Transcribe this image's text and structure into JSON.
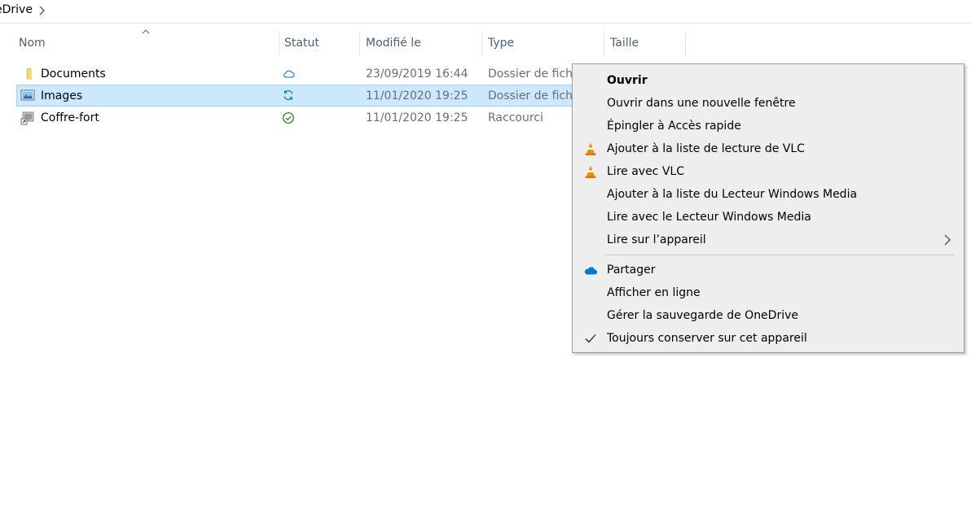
{
  "breadcrumb": {
    "text": "eDrive"
  },
  "columns": {
    "name": "Nom",
    "status": "Statut",
    "modified": "Modifié le",
    "type": "Type",
    "size": "Taille"
  },
  "rows": [
    {
      "name": "Documents",
      "icon": "folder-icon",
      "status": "cloud-icon",
      "modified": "23/09/2019 16:44",
      "type": "Dossier de fichiers"
    },
    {
      "name": "Images",
      "icon": "pictures-folder-icon",
      "status": "sync-icon",
      "modified": "11/01/2020 19:25",
      "type": "Dossier de fichiers"
    },
    {
      "name": "Coffre-fort",
      "icon": "shortcut-icon",
      "status": "check-circle-icon",
      "modified": "11/01/2020 19:25",
      "type": "Raccourci"
    }
  ],
  "context_menu": {
    "items": [
      {
        "label": "Ouvrir",
        "bold": true
      },
      {
        "label": "Ouvrir dans une nouvelle fenêtre"
      },
      {
        "label": "Épingler à Accès rapide"
      },
      {
        "label": "Ajouter à la liste de lecture de VLC",
        "icon": "vlc-cone-icon"
      },
      {
        "label": "Lire avec VLC",
        "icon": "vlc-cone-icon"
      },
      {
        "label": "Ajouter à la liste du Lecteur Windows Media"
      },
      {
        "label": "Lire avec le Lecteur Windows Media"
      },
      {
        "label": "Lire sur l’appareil",
        "submenu": true
      },
      {
        "label": "Partager",
        "icon": "onedrive-cloud-icon"
      },
      {
        "label": "Afficher en ligne"
      },
      {
        "label": "Gérer la sauvegarde de OneDrive"
      },
      {
        "label": "Toujours conserver sur cet appareil",
        "icon": "checkmark-icon",
        "checked": true
      }
    ]
  },
  "colors": {
    "selection_bg": "#cce8ff",
    "selection_border": "#99d1ff",
    "header_text": "#4c607a",
    "onedrive_blue": "#0078d4",
    "status_green": "#107c10",
    "vlc_orange": "#f08c00"
  }
}
